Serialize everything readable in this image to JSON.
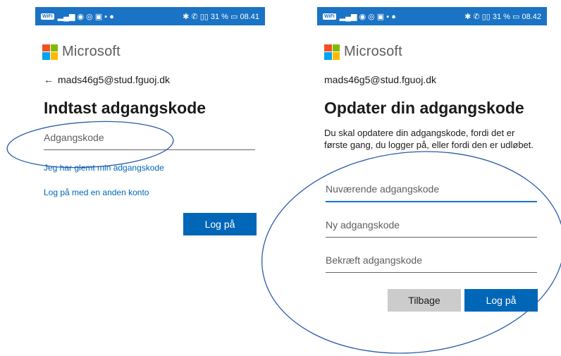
{
  "left": {
    "status": {
      "wifi": "WiFi",
      "right_text": "✱ ✆ ▯▯ 31 % ▭ 08.41"
    },
    "brand": "Microsoft",
    "back_icon": "arrow-left-icon",
    "email": "mads46g5@stud.fguoj.dk",
    "title": "Indtast adgangskode",
    "password_placeholder": "Adgangskode",
    "forgot_link": "Jeg har glemt min adgangskode",
    "other_account_link": "Log på med en anden konto",
    "sign_in_label": "Log på"
  },
  "right": {
    "status": {
      "wifi": "WiFi",
      "right_text": "✱ ✆ ▯▯ 31 % ▭ 08.42"
    },
    "brand": "Microsoft",
    "email": "mads46g5@stud.fguoj.dk",
    "title": "Opdater din adgangskode",
    "description": "Du skal opdatere din adgangskode, fordi det er første gang, du logger på, eller fordi den er udløbet.",
    "current_password_placeholder": "Nuværende adgangskode",
    "new_password_placeholder": "Ny adgangskode",
    "confirm_password_placeholder": "Bekræft adgangskode",
    "back_label": "Tilbage",
    "sign_in_label": "Log på"
  },
  "colors": {
    "accent": "#0067b8",
    "statusbar": "#1a73c4",
    "annotation": "#2a5caa",
    "ms_red": "#f25022",
    "ms_green": "#7fba00",
    "ms_blue": "#00a4ef",
    "ms_yellow": "#ffb900"
  }
}
